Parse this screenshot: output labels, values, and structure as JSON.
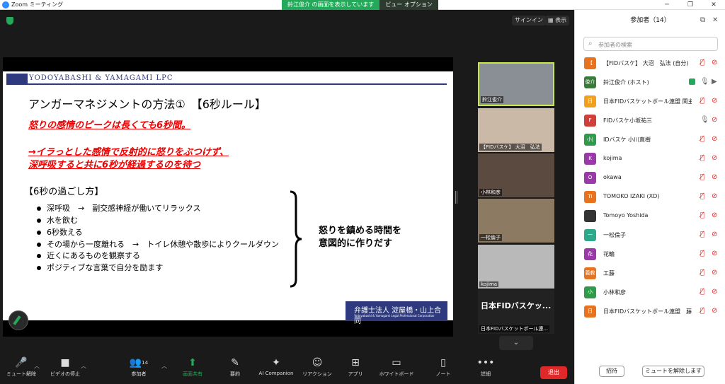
{
  "window": {
    "title": "Zoom ミーティング"
  },
  "share_banner": {
    "label": "鈴江俊介 の画面を表示しています",
    "option": "ビュー オプション"
  },
  "top_buttons": {
    "signin": "サインイン",
    "view": "表示"
  },
  "slide": {
    "firm_header": "YODOYABASHI & YAMAGAMI LPC",
    "title": "アンガーマネジメントの方法①　【6秒ルール】",
    "red1": "怒りの感情のピークは長くても6秒間。",
    "red2a": "→イラっとした感情で反射的に怒りをぶつけず、",
    "red2b": "深呼吸すると共に6秒が経過するのを待つ",
    "subhead": "【6秒の過ごし方】",
    "bullets": [
      "深呼吸　→　副交感神経が働いてリラックス",
      "水を飲む",
      "6秒数える",
      "その場から一度離れる　→　トイレ休憩や散歩によりクールダウン",
      "近くにあるものを観察する",
      "ポジティブな言葉で自分を励ます"
    ],
    "brace_text1": "怒りを鎮める時間を",
    "brace_text2": "意図的に作りだす",
    "firm_box_jp": "弁護士法人 淀屋橋・山上合同",
    "firm_box_en": "Yodoyabashi & Yamagami Legal Professional Corporation"
  },
  "video_tiles": [
    {
      "name": "鈴江俊介",
      "bg": "#8a8f96"
    },
    {
      "name": "【FIDバスケ】 大沼　弘法",
      "bg": "#c9b9a6"
    },
    {
      "name": "小林和彦",
      "bg": "#5b4a40"
    },
    {
      "name": "一松倫子",
      "bg": "#8c7b62"
    },
    {
      "name": "kojima",
      "bg": "#b9b9b9"
    },
    {
      "name": "日本FIDバスケットボール連...",
      "big": "日本FIDバスケッ..."
    }
  ],
  "toolbar": {
    "mute": "ミュート解除",
    "video": "ビデオの停止",
    "participants": "参加者",
    "participants_count": "14",
    "share": "画面共有",
    "summary": "要約",
    "ai": "AI Companion",
    "reaction": "リアクション",
    "apps": "アプリ",
    "whiteboard": "ホワイトボード",
    "notes": "ノート",
    "more": "詳細",
    "end": "退出"
  },
  "panel": {
    "title": "参加者（14）",
    "search_placeholder": "参加者の検索",
    "participants": [
      {
        "avatar": "【",
        "color": "#e8731f",
        "name": "【FIDバスケ】 大沼　弘法 (自分)",
        "mic": "off",
        "cam": "off"
      },
      {
        "avatar": "俊介",
        "color": "#3a7a3a",
        "name": "鈴江俊介 (ホスト)",
        "mic": "on",
        "cam": "on",
        "share": true
      },
      {
        "avatar": "日",
        "color": "#f0a020",
        "name": "日本FIDバスケットボール連盟 関主...",
        "mic": "off",
        "cam": "off"
      },
      {
        "avatar": "F",
        "color": "#d0403a",
        "name": "FIDバスケ小坂祐三",
        "mic": "on",
        "cam": "off"
      },
      {
        "avatar": "小|",
        "color": "#2e9a4a",
        "name": "IDバスケ 小川直樹",
        "mic": "off",
        "cam": "off"
      },
      {
        "avatar": "K",
        "color": "#9a3aa8",
        "name": "kojima",
        "mic": "off",
        "cam": "off"
      },
      {
        "avatar": "O",
        "color": "#9a3aa8",
        "name": "okawa",
        "mic": "off",
        "cam": "off"
      },
      {
        "avatar": "TI",
        "color": "#e8731f",
        "name": "TOMOKO IZAKI (XD)",
        "mic": "off",
        "cam": "off"
      },
      {
        "avatar": "",
        "color": "#333333",
        "name": "Tomoyo Yoshida",
        "mic": "off",
        "cam": "off"
      },
      {
        "avatar": "一",
        "color": "#2ea88a",
        "name": "一松倫子",
        "mic": "off",
        "cam": "off"
      },
      {
        "avatar": "花",
        "color": "#9a3aa8",
        "name": "花輪",
        "mic": "off",
        "cam": "off"
      },
      {
        "avatar": "義教",
        "color": "#e8731f",
        "name": "工藤",
        "mic": "off",
        "cam": "off"
      },
      {
        "avatar": "小",
        "color": "#2e9a4a",
        "name": "小林和彦",
        "mic": "off",
        "cam": "off"
      },
      {
        "avatar": "日",
        "color": "#e8731f",
        "name": "日本FIDバスケットボール連盟　藤...",
        "mic": "off",
        "cam": "off"
      }
    ],
    "invite": "招待",
    "unmute_me": "ミュートを解除します"
  }
}
